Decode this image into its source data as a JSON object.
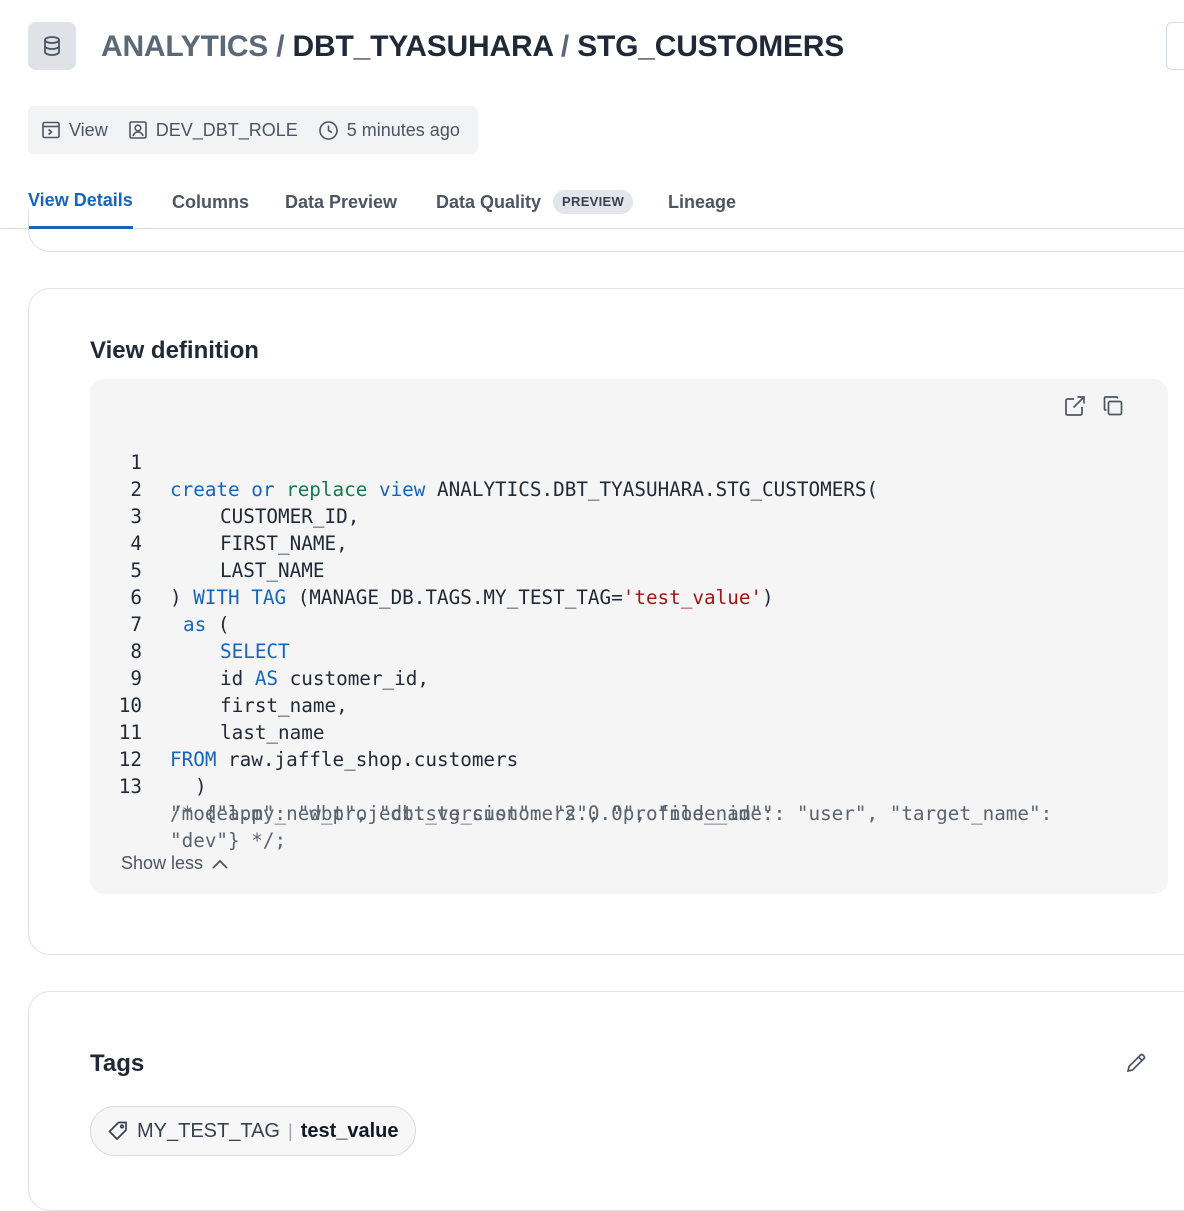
{
  "header": {
    "db": "ANALYTICS",
    "separator": "/",
    "schema": "DBT_TYASUHARA",
    "object": "STG_CUSTOMERS"
  },
  "meta": {
    "type": "View",
    "role": "DEV_DBT_ROLE",
    "updated": "5 minutes ago"
  },
  "tabs": [
    {
      "label": "View Details",
      "active": true
    },
    {
      "label": "Columns"
    },
    {
      "label": "Data Preview"
    },
    {
      "label": "Data Quality",
      "badge": "PREVIEW"
    },
    {
      "label": "Lineage"
    }
  ],
  "view_definition": {
    "title": "View definition",
    "line_numbers": [
      "1",
      "2",
      "3",
      "4",
      "5",
      "6",
      "7",
      "8",
      "9",
      "10",
      "11",
      "12",
      "13"
    ],
    "code": {
      "l1": {
        "k1": "create",
        "k2": "or",
        "k3": "replace",
        "k4": "view",
        "rest": "ANALYTICS.DBT_TYASUHARA.STG_CUSTOMERS("
      },
      "l2": "CUSTOMER_ID,",
      "l3": "FIRST_NAME,",
      "l4": "LAST_NAME",
      "l5": {
        "pre": ") ",
        "k1": "WITH",
        "k2": "TAG",
        "mid": " (MANAGE_DB.TAGS.MY_TEST_TAG=",
        "str": "'test_value'",
        "post": ")"
      },
      "l6": {
        "k": "as",
        "rest": " ("
      },
      "l7": "SELECT",
      "l8": {
        "a": "id ",
        "k": "AS",
        "b": " customer_id,"
      },
      "l9": "first_name,",
      "l10": "last_name",
      "l11": {
        "k": "FROM",
        "rest": " raw.jaffle_shop.customers"
      },
      "l12": ")",
      "l13": [
        "/* {\"app\": \"dbt\", \"dbt_version\": \"2.0.0\", \"node_id\":",
        "\"model.my_new_project.stg_customers\", \"profile_name\": \"user\", \"target_name\":",
        "\"dev\"} */;"
      ]
    },
    "show_less": "Show less"
  },
  "tags": {
    "title": "Tags",
    "items": [
      {
        "key": "MY_TEST_TAG",
        "sep": "|",
        "value": "test_value"
      }
    ]
  },
  "colors": {
    "accent": "#1565c0",
    "keyword": "#1565c0",
    "keyword_alt": "#137a4a",
    "string": "#a31515"
  }
}
